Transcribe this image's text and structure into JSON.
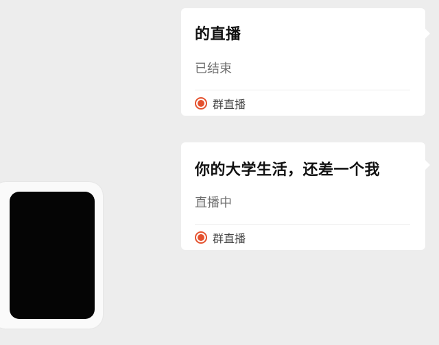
{
  "messages": [
    {
      "title": "的直播",
      "status": "已结束",
      "source": "群直播",
      "icon": "live-record-icon"
    },
    {
      "title": "你的大学生活，还差一个我",
      "status": "直播中",
      "source": "群直播",
      "icon": "live-record-icon"
    }
  ],
  "colors": {
    "background": "#ededed",
    "card": "#ffffff",
    "accent": "#e4512e"
  }
}
